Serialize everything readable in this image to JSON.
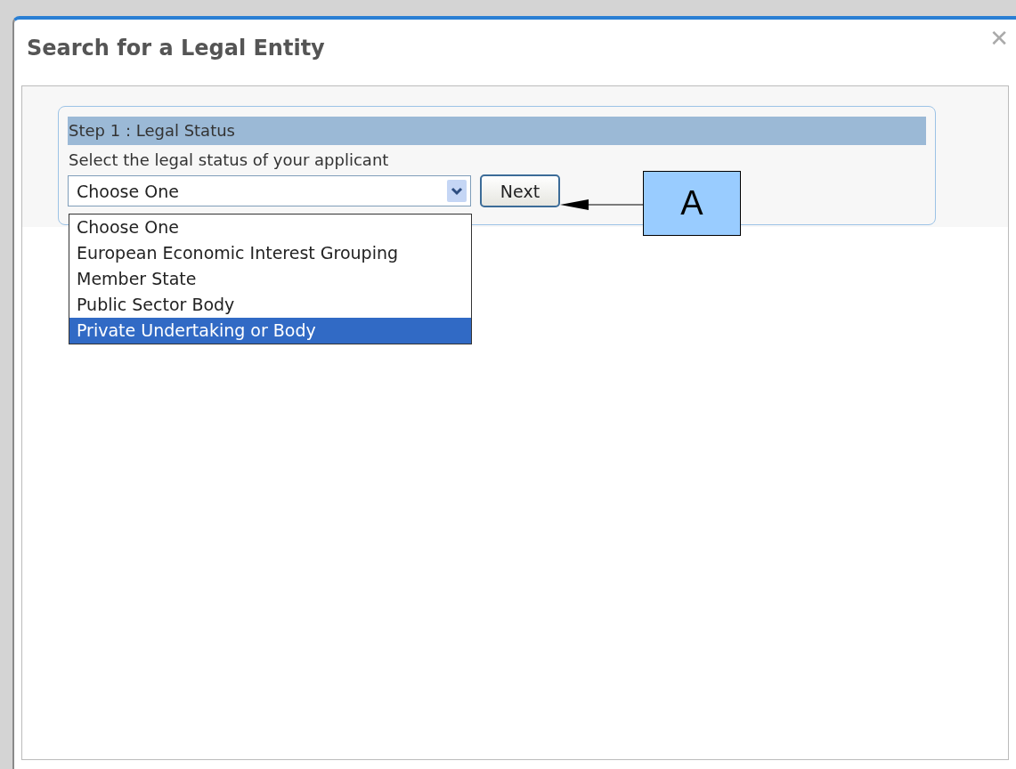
{
  "dialog": {
    "title": "Search for a Legal Entity",
    "close": "✕"
  },
  "step": {
    "title": "Step 1 : Legal Status",
    "instruction": "Select the legal status of your applicant"
  },
  "select": {
    "value": "Choose One",
    "expanded": true,
    "options": [
      {
        "label": "Choose One",
        "highlighted": false
      },
      {
        "label": "European Economic Interest Grouping",
        "highlighted": false
      },
      {
        "label": "Member State",
        "highlighted": false
      },
      {
        "label": "Public Sector Body",
        "highlighted": false
      },
      {
        "label": "Private Undertaking or Body",
        "highlighted": true
      }
    ]
  },
  "next_button": "Next",
  "annotation": {
    "label": "A"
  }
}
